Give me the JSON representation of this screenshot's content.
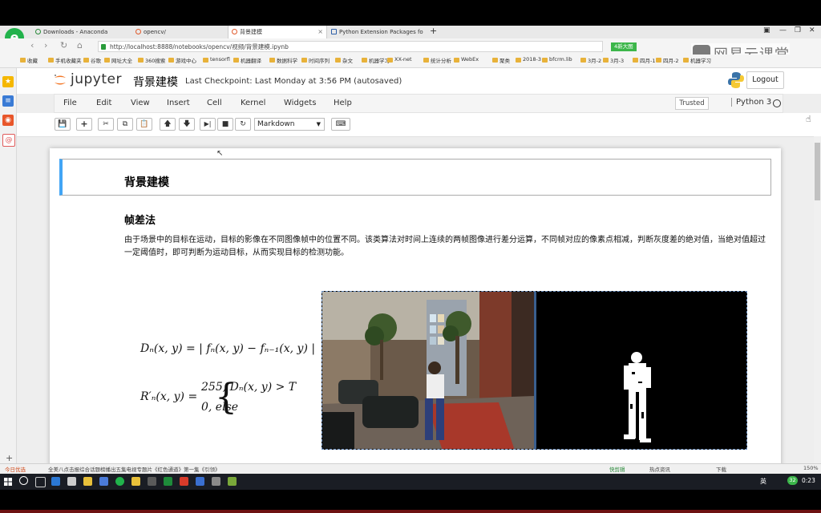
{
  "browser": {
    "tabs": [
      {
        "label": "Downloads - Anaconda"
      },
      {
        "label": "opencv/"
      },
      {
        "label": "背景建模"
      },
      {
        "label": "Python Extension Packages fo"
      }
    ],
    "url": "http://localhost:8888/notebooks/opencv/视频/背景建模.ipynb",
    "badge": "4新大图",
    "watermark": "网易云课堂",
    "bookmarks": [
      "收藏",
      "手机收藏夹",
      "谷歌",
      "网址大全",
      "360搜索",
      "游戏中心",
      "tensorfl",
      "机器翻译",
      "数据科学",
      "时间序列",
      "杂文",
      "机器学习",
      "XX-net",
      "统计分析",
      "WebEx",
      "聚类",
      "2018-3",
      "bfcrm.lib",
      "3月-2",
      "3月-3",
      "四月-1",
      "四月-2",
      "机器学习"
    ]
  },
  "jupyter": {
    "logo_text": "jupyter",
    "notebook_name": "背景建模",
    "checkpoint": "Last Checkpoint: Last Monday at 3:56 PM (autosaved)",
    "logout_label": "Logout",
    "menu": [
      "File",
      "Edit",
      "View",
      "Insert",
      "Cell",
      "Kernel",
      "Widgets",
      "Help"
    ],
    "trusted_label": "Trusted",
    "kernel_label": "Python 3",
    "cell_type": "Markdown"
  },
  "cells": {
    "heading1": "背景建模",
    "heading2": "帧差法",
    "paragraph": "由于场景中的目标在运动，目标的影像在不同图像帧中的位置不同。该类算法对时间上连续的两帧图像进行差分运算，不同帧对应的像素点相减，判断灰度差的绝对值，当绝对值超过一定阈值时，即可判断为运动目标，从而实现目标的检测功能。",
    "formula1": "Dₙ(x, y) = | fₙ(x, y) − fₙ₋₁(x, y) |",
    "formula2_lhs": "R′ₙ(x, y) =",
    "formula2_case1": "255, Dₙ(x, y) > T",
    "formula2_case2": "0, else"
  },
  "statusbar": {
    "left": "今日优选",
    "news": "全美八点击报综合话题榜播出五集电视专题片《红色通道》第一集《引领》",
    "right": [
      "快剪辑",
      "热点资讯",
      "下载",
      "150%"
    ]
  },
  "taskbar": {
    "clock": "0:23",
    "lang": "英",
    "badge": "32"
  },
  "colors": {
    "jupyter_orange": "#f37726",
    "selected_cell_border": "#42a5f5",
    "browser_green": "#21b24b"
  }
}
